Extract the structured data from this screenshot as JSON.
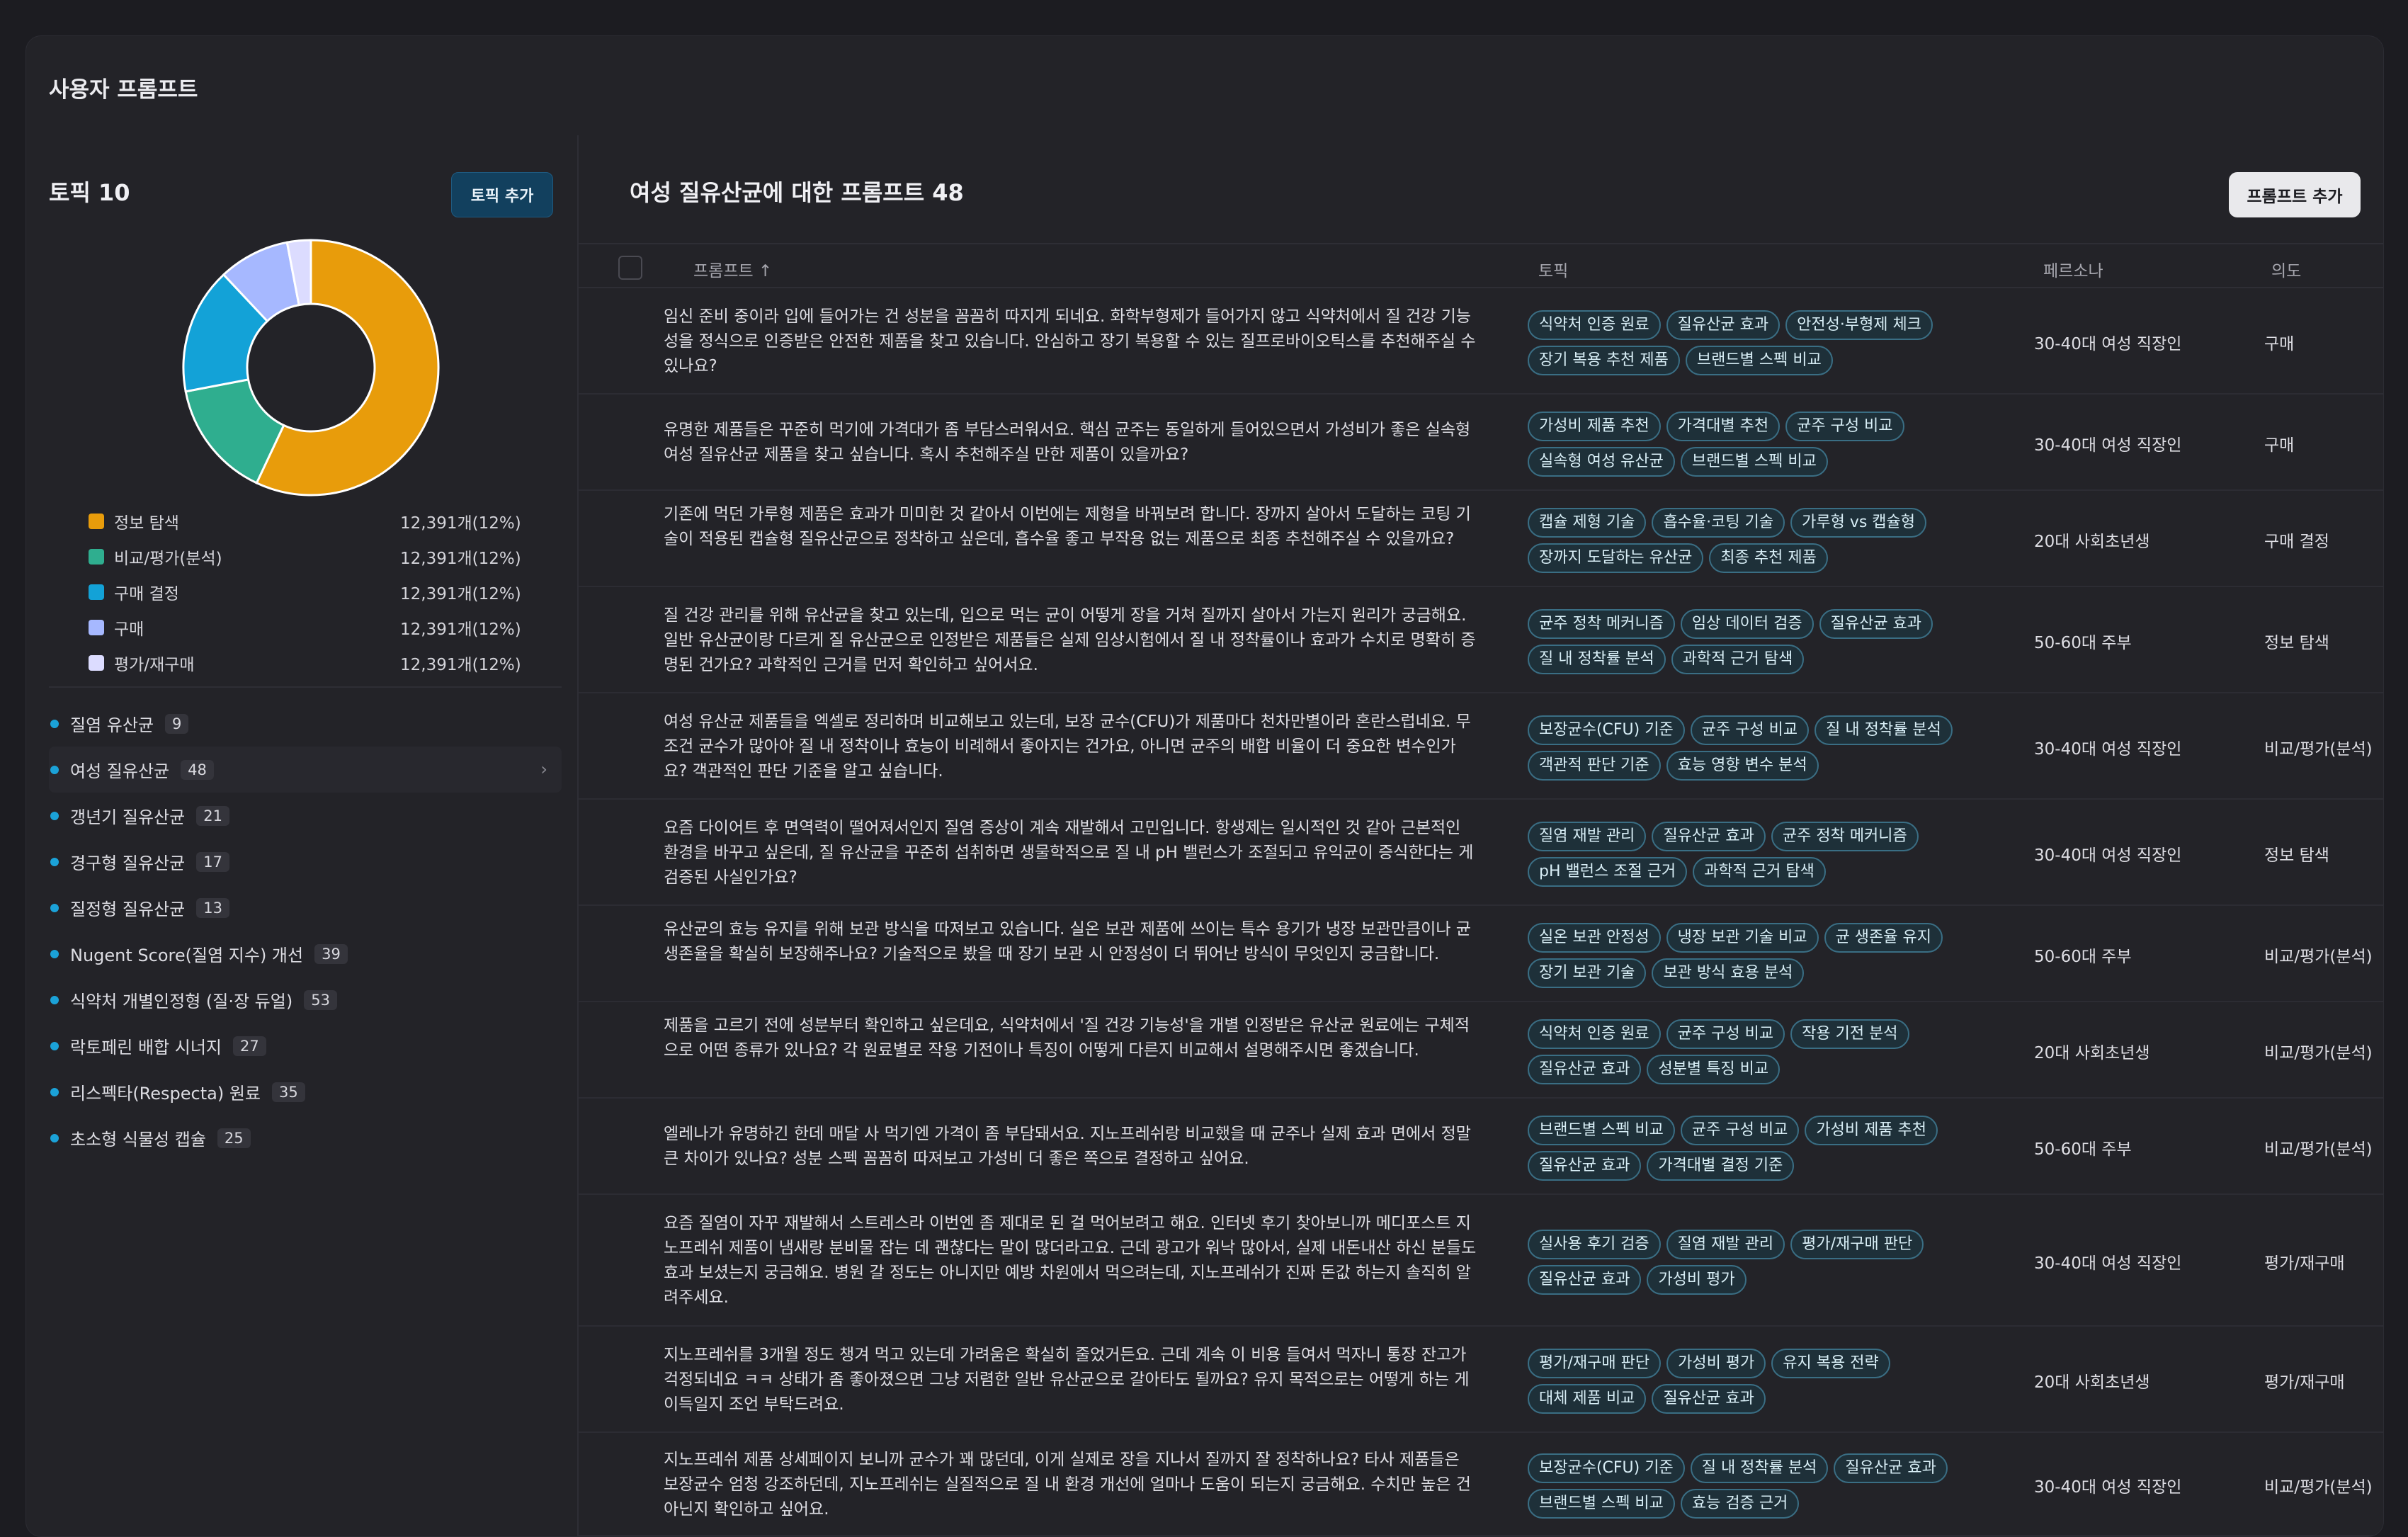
{
  "page_title": "사용자 프롬프트",
  "left": {
    "topic_count_label": "토픽 10",
    "add_topic_button": "토픽 추가",
    "legend": [
      {
        "label": "정보 탐색",
        "value": "12,391개(12%)",
        "color": "#e89c0b"
      },
      {
        "label": "비교/평가(분석)",
        "value": "12,391개(12%)",
        "color": "#2fae8f"
      },
      {
        "label": "구매 결정",
        "value": "12,391개(12%)",
        "color": "#13a2d7"
      },
      {
        "label": "구매",
        "value": "12,391개(12%)",
        "color": "#a6b8ff"
      },
      {
        "label": "평가/재구매",
        "value": "12,391개(12%)",
        "color": "#dcdcff"
      }
    ],
    "donut_shares": [
      0.57,
      0.15,
      0.16,
      0.09,
      0.03
    ],
    "topics": [
      {
        "name": "질염 유산균",
        "count": "9"
      },
      {
        "name": "여성 질유산균",
        "count": "48"
      },
      {
        "name": "갱년기 질유산균",
        "count": "21"
      },
      {
        "name": "경구형 질유산균",
        "count": "17"
      },
      {
        "name": "질정형 질유산균",
        "count": "13"
      },
      {
        "name": "Nugent Score(질염 지수) 개선",
        "count": "39"
      },
      {
        "name": "식약처 개별인정형 (질·장 듀얼)",
        "count": "53"
      },
      {
        "name": "락토페린 배합 시너지",
        "count": "27"
      },
      {
        "name": "리스펙타(Respecta) 원료",
        "count": "35"
      },
      {
        "name": "초소형 식물성 캡슐",
        "count": "25"
      }
    ]
  },
  "right": {
    "title": "여성 질유산균에 대한 프롬프트 48",
    "add_prompt_button": "프롬프트 추가",
    "headers": {
      "prompt": "프롬프트 ↑",
      "topic": "토픽",
      "persona": "페르소나",
      "intent": "의도"
    },
    "rows": [
      {
        "prompt": "임신 준비 중이라 입에 들어가는 건 성분을 꼼꼼히 따지게 되네요. 화학부형제가 들어가지 않고 식약처에서 질 건강 기능성을 정식으로 인증받은 안전한 제품을 찾고 있습니다. 안심하고 장기 복용할 수 있는 질프로바이오틱스를 추천해주실 수 있나요?",
        "tags": [
          "식약처 인증 원료",
          "질유산균 효과",
          "안전성·부형제 체크",
          "장기 복용 추천 제품",
          "브랜드별 스펙 비교"
        ],
        "persona": "30-40대 여성 직장인",
        "intent": "구매"
      },
      {
        "prompt": "유명한 제품들은 꾸준히 먹기에 가격대가 좀 부담스러워서요. 핵심 균주는 동일하게 들어있으면서 가성비가 좋은 실속형 여성 질유산균 제품을 찾고 싶습니다. 혹시 추천해주실 만한 제품이 있을까요?",
        "tags": [
          "가성비 제품 추천",
          "가격대별 추천",
          "균주 구성 비교",
          "실속형 여성 유산균",
          "브랜드별 스펙 비교"
        ],
        "persona": "30-40대 여성 직장인",
        "intent": "구매"
      },
      {
        "prompt": "기존에 먹던 가루형 제품은 효과가 미미한 것 같아서 이번에는 제형을 바꿔보려 합니다. 장까지 살아서 도달하는 코팅 기술이 적용된 캡슐형 질유산균으로 정착하고 싶은데, 흡수율 좋고 부작용 없는 제품으로 최종 추천해주실 수 있을까요?",
        "tags": [
          "캡슐 제형 기술",
          "흡수율·코팅 기술",
          "가루형 vs 캡슐형",
          "장까지 도달하는 유산균",
          "최종 추천 제품"
        ],
        "persona": "20대 사회초년생",
        "intent": "구매 결정"
      },
      {
        "prompt": "질 건강 관리를 위해 유산균을 찾고 있는데, 입으로 먹는 균이 어떻게 장을 거쳐 질까지 살아서 가는지 원리가 궁금해요. 일반 유산균이랑 다르게 질 유산균으로 인정받은 제품들은 실제 임상시험에서 질 내 정착률이나 효과가 수치로 명확히 증명된 건가요? 과학적인 근거를 먼저 확인하고 싶어서요.",
        "tags": [
          "균주 정착 메커니즘",
          "임상 데이터 검증",
          "질유산균 효과",
          "질 내 정착률 분석",
          "과학적 근거 탐색"
        ],
        "persona": "50-60대 주부",
        "intent": "정보 탐색"
      },
      {
        "prompt": "여성 유산균 제품들을 엑셀로 정리하며 비교해보고 있는데, 보장 균수(CFU)가 제품마다 천차만별이라 혼란스럽네요. 무조건 균수가 많아야 질 내 정착이나 효능이 비례해서 좋아지는 건가요, 아니면 균주의 배합 비율이 더 중요한 변수인가요? 객관적인 판단 기준을 알고 싶습니다.",
        "tags": [
          "보장균수(CFU) 기준",
          "균주 구성 비교",
          "질 내 정착률 분석",
          "객관적 판단 기준",
          "효능 영향 변수 분석"
        ],
        "persona": "30-40대 여성 직장인",
        "intent": "비교/평가(분석)"
      },
      {
        "prompt": "요즘 다이어트 후 면역력이 떨어져서인지 질염 증상이 계속 재발해서 고민입니다. 항생제는 일시적인 것 같아 근본적인 환경을 바꾸고 싶은데, 질 유산균을 꾸준히 섭취하면 생물학적으로 질 내 pH 밸런스가 조절되고 유익균이 증식한다는 게 검증된 사실인가요?",
        "tags": [
          "질염 재발 관리",
          "질유산균 효과",
          "균주 정착 메커니즘",
          "pH 밸런스 조절 근거",
          "과학적 근거 탐색"
        ],
        "persona": "30-40대 여성 직장인",
        "intent": "정보 탐색"
      },
      {
        "prompt": "유산균의 효능 유지를 위해 보관 방식을 따져보고 있습니다. 실온 보관 제품에 쓰이는 특수 용기가 냉장 보관만큼이나 균 생존율을 확실히 보장해주나요? 기술적으로 봤을 때 장기 보관 시 안정성이 더 뛰어난 방식이 무엇인지 궁금합니다.",
        "tags": [
          "실온 보관 안정성",
          "냉장 보관 기술 비교",
          "균 생존율 유지",
          "장기 보관 기술",
          "보관 방식 효용 분석"
        ],
        "persona": "50-60대 주부",
        "intent": "비교/평가(분석)"
      },
      {
        "prompt": "제품을 고르기 전에 성분부터 확인하고 싶은데요, 식약처에서 '질 건강 기능성'을 개별 인정받은 유산균 원료에는 구체적으로 어떤 종류가 있나요? 각 원료별로 작용 기전이나 특징이 어떻게 다른지 비교해서 설명해주시면 좋겠습니다.",
        "tags": [
          "식약처 인증 원료",
          "균주 구성 비교",
          "작용 기전 분석",
          "질유산균 효과",
          "성분별 특징 비교"
        ],
        "persona": "20대 사회초년생",
        "intent": "비교/평가(분석)"
      },
      {
        "prompt": "엘레나가 유명하긴 한데 매달 사 먹기엔 가격이 좀 부담돼서요. 지노프레쉬랑 비교했을 때 균주나 실제 효과 면에서 정말 큰 차이가 있나요? 성분 스펙 꼼꼼히 따져보고 가성비 더 좋은 쪽으로 결정하고 싶어요.",
        "tags": [
          "브랜드별 스펙 비교",
          "균주 구성 비교",
          "가성비 제품 추천",
          "질유산균 효과",
          "가격대별 결정 기준"
        ],
        "persona": "50-60대 주부",
        "intent": "비교/평가(분석)"
      },
      {
        "prompt": "요즘 질염이 자꾸 재발해서 스트레스라 이번엔 좀 제대로 된 걸 먹어보려고 해요. 인터넷 후기 찾아보니까 메디포스트 지노프레쉬 제품이 냄새랑 분비물 잡는 데 괜찮다는 말이 많더라고요. 근데 광고가 워낙 많아서, 실제 내돈내산 하신 분들도 효과 보셨는지 궁금해요. 병원 갈 정도는 아니지만 예방 차원에서 먹으려는데, 지노프레쉬가 진짜 돈값 하는지 솔직히 알려주세요.",
        "tags": [
          "실사용 후기 검증",
          "질염 재발 관리",
          "평가/재구매 판단",
          "질유산균 효과",
          "가성비 평가"
        ],
        "persona": "30-40대 여성 직장인",
        "intent": "평가/재구매"
      },
      {
        "prompt": "지노프레쉬를 3개월 정도 챙겨 먹고 있는데 가려움은 확실히 줄었거든요. 근데 계속 이 비용 들여서 먹자니 통장 잔고가 걱정되네요 ㅋㅋ 상태가 좀 좋아졌으면 그냥 저렴한 일반 유산균으로 갈아타도 될까요? 유지 목적으로는 어떻게 하는 게 이득일지 조언 부탁드려요.",
        "tags": [
          "평가/재구매 판단",
          "가성비 평가",
          "유지 복용 전략",
          "대체 제품 비교",
          "질유산균 효과"
        ],
        "persona": "20대 사회초년생",
        "intent": "평가/재구매"
      },
      {
        "prompt": "지노프레쉬 제품 상세페이지 보니까 균수가 꽤 많던데, 이게 실제로 장을 지나서 질까지 잘 정착하나요? 타사 제품들은 보장균수 엄청 강조하던데, 지노프레쉬는 실질적으로 질 내 환경 개선에 얼마나 도움이 되는지 궁금해요. 수치만 높은 건 아닌지 확인하고 싶어요.",
        "tags": [
          "보장균수(CFU) 기준",
          "질 내 정착률 분석",
          "질유산균 효과",
          "브랜드별 스펙 비교",
          "효능 검증 근거"
        ],
        "persona": "30-40대 여성 직장인",
        "intent": "비교/평가(분석)"
      }
    ]
  }
}
